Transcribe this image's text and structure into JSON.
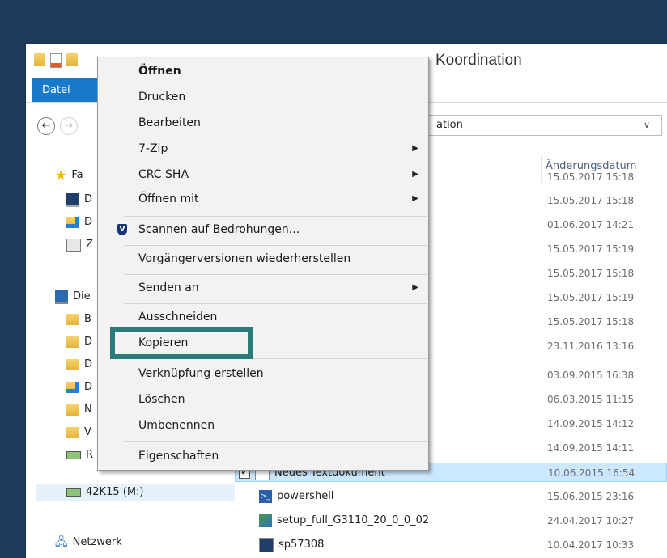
{
  "window": {
    "title": "Koordination",
    "tab_file": "Datei",
    "address_partial": "ation"
  },
  "columns": {
    "date": "Änderungsdatum",
    "clipped_date": "15.05.2017 15:18"
  },
  "sidebar": {
    "items": [
      {
        "label": "Fa",
        "icon": "star-icon"
      },
      {
        "label": "D",
        "icon": "desktop-icon"
      },
      {
        "label": "D",
        "icon": "downloads-folder-icon"
      },
      {
        "label": "Z",
        "icon": "recent-places-icon"
      },
      {
        "label": "Die",
        "icon": "this-pc-icon"
      },
      {
        "label": "B",
        "icon": "folder-icon"
      },
      {
        "label": "D",
        "icon": "folder-icon"
      },
      {
        "label": "D",
        "icon": "folder-icon"
      },
      {
        "label": "D",
        "icon": "downloads-folder-icon"
      },
      {
        "label": "N",
        "icon": "music-folder-icon"
      },
      {
        "label": "V",
        "icon": "video-folder-icon"
      },
      {
        "label": "R",
        "icon": "network-drive-icon"
      },
      {
        "label": "42K15 (M:)",
        "icon": "network-drive-icon"
      },
      {
        "label": "Netzwerk",
        "icon": "network-icon"
      }
    ]
  },
  "files": {
    "dates": [
      "15.05.2017 15:18",
      "01.06.2017 14:21",
      "15.05.2017 15:19",
      "15.05.2017 15:18",
      "15.05.2017 15:19",
      "15.05.2017 15:18",
      "23.11.2016 13:16",
      "03.09.2015 16:38",
      "06.03.2015 11:15",
      "14.09.2015 14:12",
      "14.09.2015 14:11"
    ],
    "named": [
      {
        "name": "Neues Textdokument",
        "date": "10.06.2015 16:54",
        "selected": true
      },
      {
        "name": "powershell",
        "date": "15.06.2015 23:16"
      },
      {
        "name": "setup_full_G3110_20_0_0_02",
        "date": "24.04.2017 10:27"
      },
      {
        "name": "sp57308",
        "date": "10.04.2017 10:33"
      }
    ]
  },
  "context_menu": {
    "items": [
      "Öffnen",
      "Drucken",
      "Bearbeiten",
      "7-Zip",
      "CRC SHA",
      "Öffnen mit",
      "Scannen auf Bedrohungen...",
      "Vorgängerversionen wiederherstellen",
      "Senden an",
      "Ausschneiden",
      "Kopieren",
      "Verknüpfung erstellen",
      "Löschen",
      "Umbenennen",
      "Eigenschaften"
    ]
  },
  "colors": {
    "desktop": "#1e3a5a",
    "accent": "#1979ca",
    "highlight_box": "#2b7a7a",
    "selection": "#cce8ff"
  }
}
